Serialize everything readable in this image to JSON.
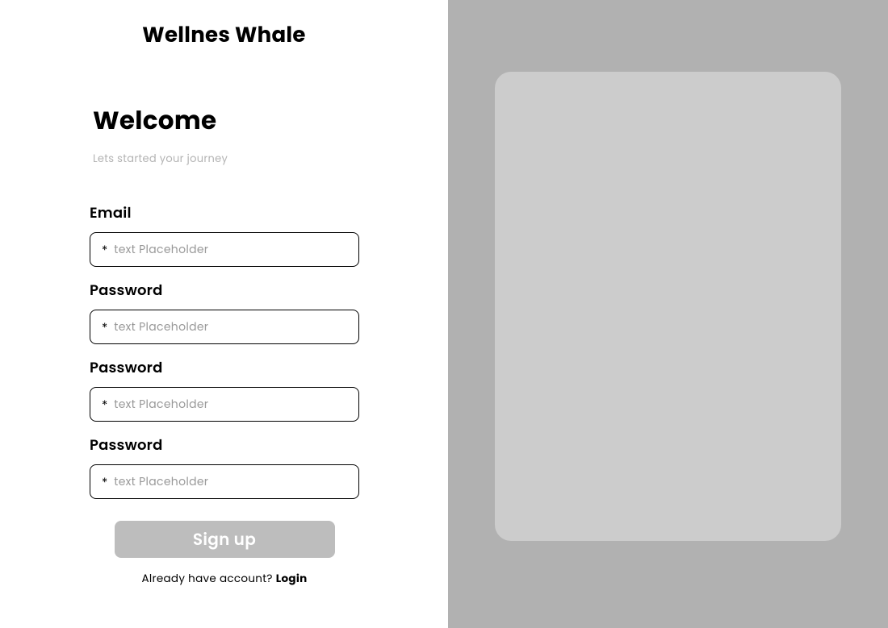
{
  "brand": {
    "title": "Wellnes Whale"
  },
  "welcome": {
    "heading": "Welcome",
    "subtext": "Lets started your journey"
  },
  "form": {
    "fields": [
      {
        "label": "Email",
        "placeholder": "text Placeholder",
        "required_mark": "*"
      },
      {
        "label": "Password",
        "placeholder": "text Placeholder",
        "required_mark": "*"
      },
      {
        "label": "Password",
        "placeholder": "text Placeholder",
        "required_mark": "*"
      },
      {
        "label": "Password",
        "placeholder": "text Placeholder",
        "required_mark": "*"
      }
    ],
    "signup_button": "Sign up",
    "login_prompt": "Already have account? ",
    "login_link": "Login"
  }
}
